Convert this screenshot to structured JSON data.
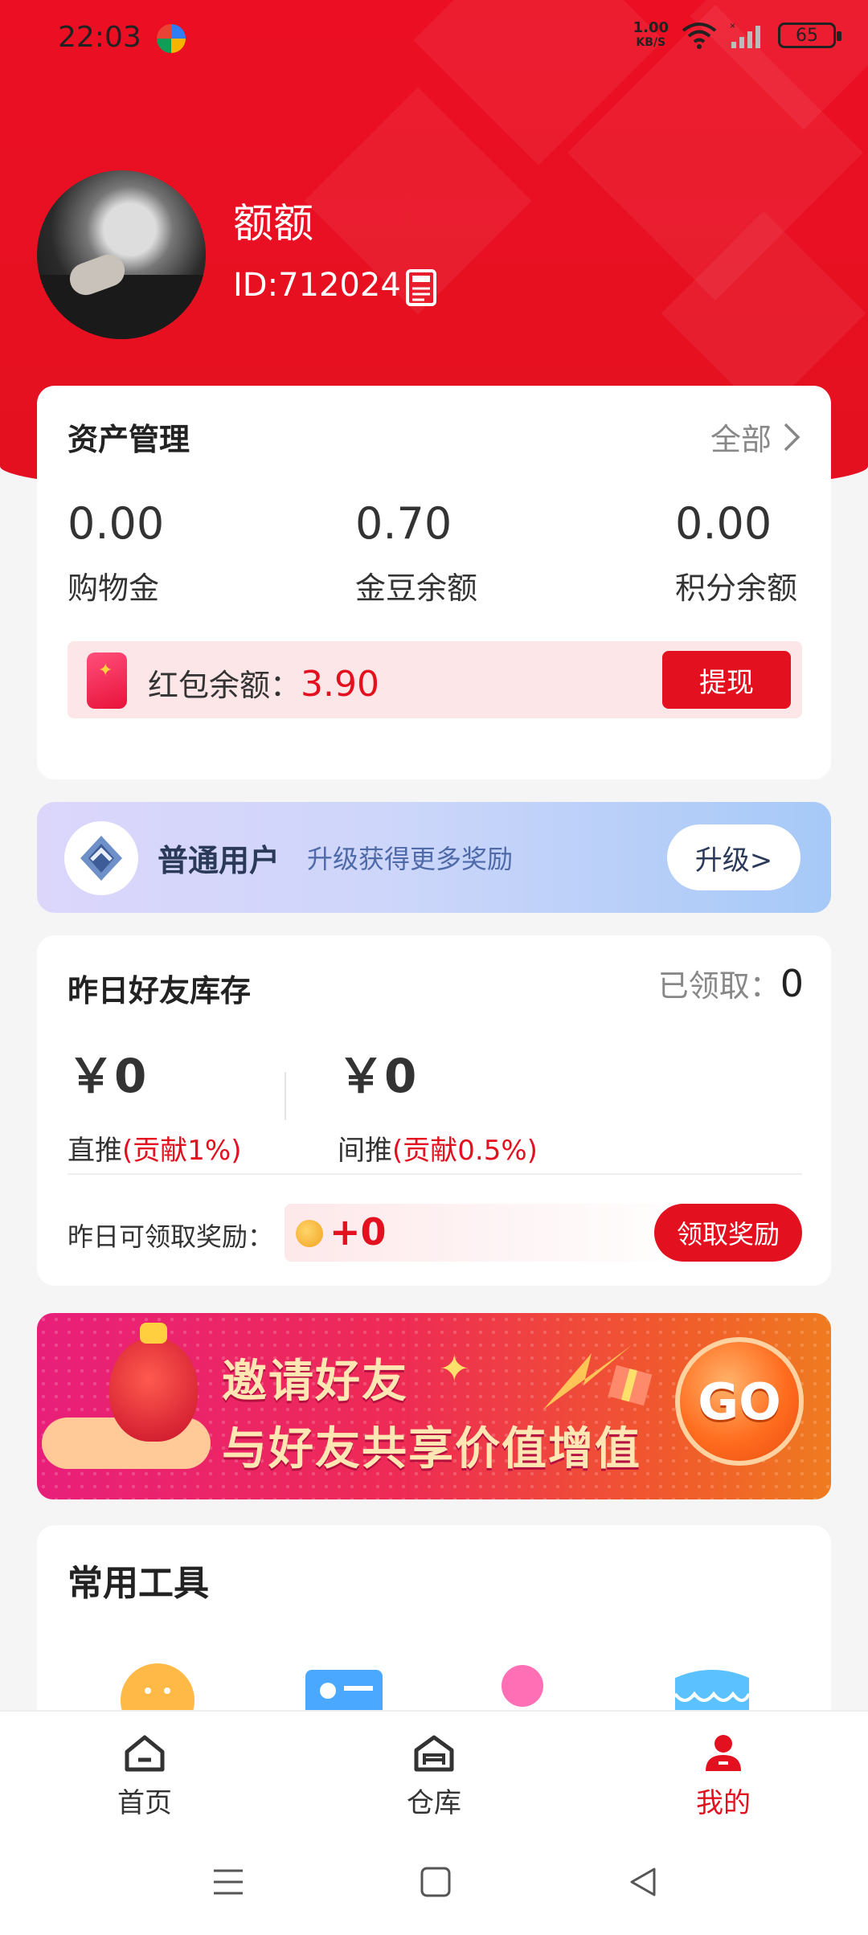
{
  "status_bar": {
    "time": "22:03",
    "net_speed_value": "1.00",
    "net_speed_unit": "KB/S",
    "battery": "65"
  },
  "profile": {
    "username": "额额",
    "user_id": "ID:712024"
  },
  "assets": {
    "title": "资产管理",
    "all_label": "全部",
    "items": [
      {
        "value": "0.00",
        "label": "购物金"
      },
      {
        "value": "0.70",
        "label": "金豆余额"
      },
      {
        "value": "0.00",
        "label": "积分余额"
      }
    ],
    "red_packet_label": "红包余额：",
    "red_packet_value": "3.90",
    "withdraw_label": "提现"
  },
  "membership": {
    "level": "普通用户",
    "subtitle": "升级获得更多奖励",
    "upgrade_label": "升级>"
  },
  "friends": {
    "title": "昨日好友库存",
    "claimed_label": "已领取：",
    "claimed_value": "0",
    "direct_value": "￥0",
    "direct_label": "直推",
    "direct_rate": "(贡献1%)",
    "indirect_value": "￥0",
    "indirect_label": "间推",
    "indirect_rate": "(贡献0.5%)",
    "reward_label": "昨日可领取奖励：",
    "reward_value": "+0",
    "claim_label": "领取奖励"
  },
  "banner": {
    "line1": "邀请好友",
    "line2": "与好友共享价值增值",
    "go_label": "GO"
  },
  "tools": {
    "title": "常用工具"
  },
  "bottom_nav": {
    "items": [
      {
        "label": "首页",
        "icon": "home-icon"
      },
      {
        "label": "仓库",
        "icon": "warehouse-icon"
      },
      {
        "label": "我的",
        "icon": "profile-icon"
      }
    ],
    "active_index": 2
  },
  "colors": {
    "brand_red": "#e3101f",
    "member_gradient_start": "#dcd6fb",
    "member_gradient_end": "#a6c9f7"
  }
}
